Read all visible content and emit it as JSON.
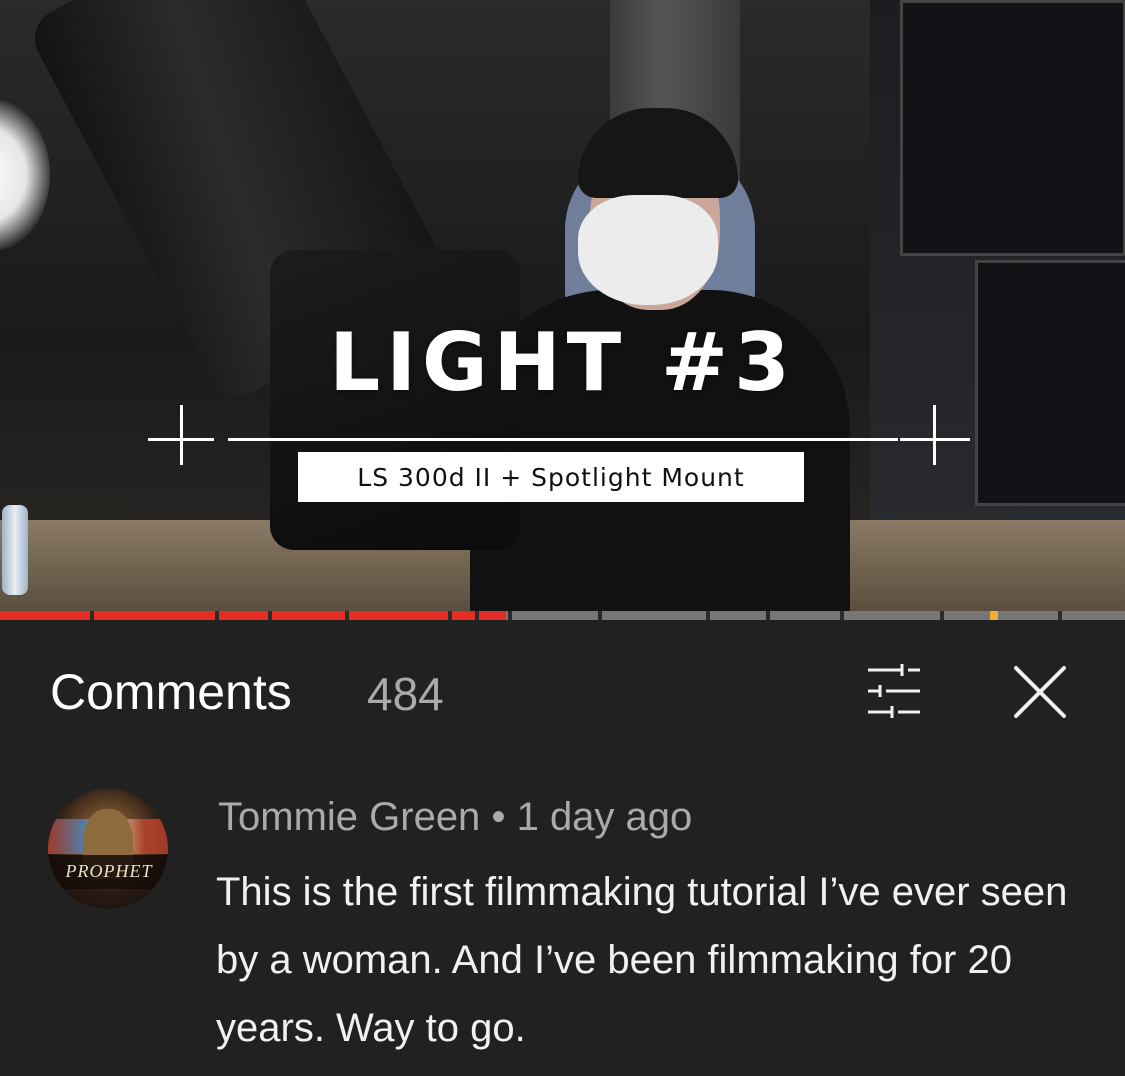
{
  "video": {
    "title": "LIGHT #3",
    "subtitle": "LS 300d II + Spotlight Mount",
    "progress_fraction": 0.45
  },
  "comments": {
    "label": "Comments",
    "count": "484",
    "filter_icon": "filter-icon",
    "close_icon": "close-icon"
  },
  "comment": {
    "author": "Tommie Green",
    "separator": "•",
    "time": "1 day ago",
    "text": "This is the first filmmaking tutorial I’ve ever seen by a woman. And I’ve been filmmaking for 20 years. Way to go.",
    "avatar_text": "PROPHET"
  },
  "colors": {
    "progress": "#e52d27",
    "panel": "#212121",
    "secondary_text": "#aaaaaa"
  }
}
